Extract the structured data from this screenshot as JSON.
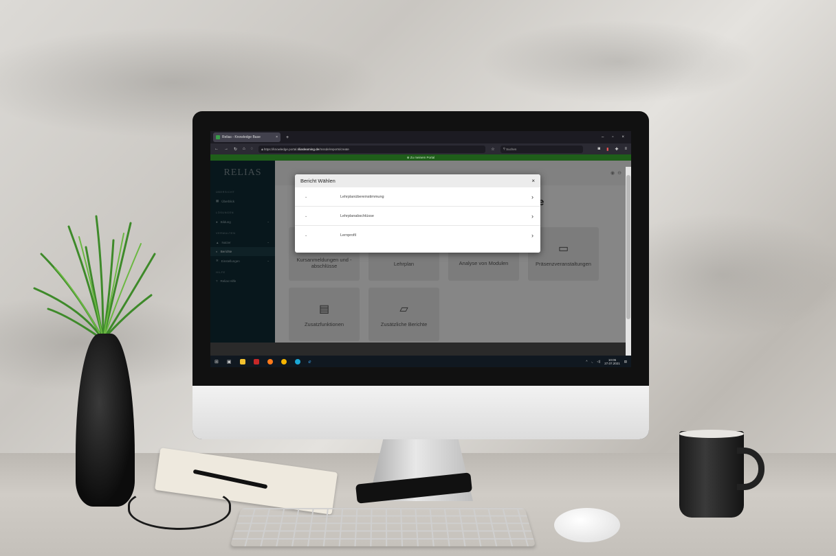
{
  "browser": {
    "tab_title": "Relias - Knowledge Base",
    "tab_close": "×",
    "new_tab": "+",
    "window_controls": [
      "–",
      "▫",
      "×"
    ],
    "url_prefix": "https://knowledge.portal.",
    "url_domain": "riliaslearning.de",
    "url_path": "/mssde/reports/create",
    "search_placeholder": "Suchen"
  },
  "portal_bar": "Zu meinem Portal",
  "sidebar": {
    "logo": "RELIAS",
    "sections": [
      {
        "title": "ÜBERSICHT",
        "items": [
          {
            "label": "Überblick",
            "icon": "dashboard-icon",
            "expandable": false
          }
        ]
      },
      {
        "title": "LÖSUNGEN",
        "items": [
          {
            "label": "Bildung",
            "icon": "lightbulb-icon",
            "expandable": true
          }
        ]
      },
      {
        "title": "VERWALTEN",
        "items": [
          {
            "label": "Nutzer",
            "icon": "users-icon",
            "expandable": true
          },
          {
            "label": "Berichte",
            "icon": "reports-icon",
            "expandable": false,
            "active": true
          },
          {
            "label": "Einstellungen",
            "icon": "gear-icon",
            "expandable": true
          }
        ]
      },
      {
        "title": "HILFE",
        "items": [
          {
            "label": "Relias Hilfe",
            "icon": "help-icon",
            "expandable": false
          }
        ]
      }
    ]
  },
  "main": {
    "heading_partial": "te",
    "cards": [
      {
        "label": "Kursanmeldungen und -abschlüsse",
        "icon": "book-icon"
      },
      {
        "label": "Lehrplan",
        "icon": "signpost-icon"
      },
      {
        "label": "Analyse von Modulen",
        "icon": "pie-chart-icon"
      },
      {
        "label": "Präsenzveranstaltungen",
        "icon": "calendar-icon"
      },
      {
        "label": "Zusatzfunktionen",
        "icon": "document-icon"
      },
      {
        "label": "Zusätzliche Berichte",
        "icon": "folder-icon"
      }
    ]
  },
  "modal": {
    "title": "Bericht Wählen",
    "close": "×",
    "rows": [
      {
        "label": "Lehrplanübereinstimmung"
      },
      {
        "label": "Lehrplanabschlüsse"
      },
      {
        "label": "Lernprofil"
      }
    ]
  },
  "taskbar": {
    "clock_time": "10:05",
    "clock_date": "27.07.2021"
  }
}
